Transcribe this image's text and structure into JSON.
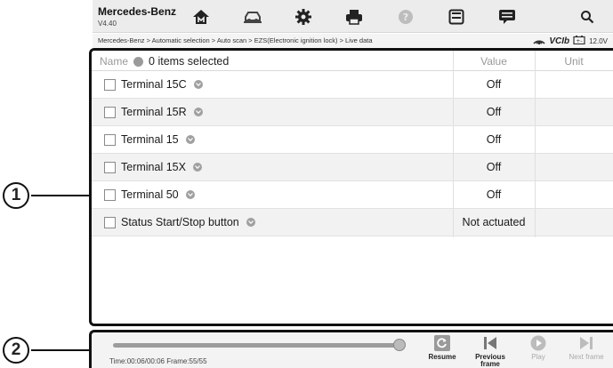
{
  "app": {
    "name": "Mercedes-Benz",
    "version": "V4.40"
  },
  "toolbar": {
    "buttons": [
      {
        "icon": "home-icon"
      },
      {
        "icon": "vehicle-icon"
      },
      {
        "icon": "settings-icon"
      },
      {
        "icon": "print-icon"
      },
      {
        "icon": "help-icon"
      },
      {
        "icon": "save-icon"
      },
      {
        "icon": "message-icon"
      },
      {
        "icon": "search-icon"
      }
    ]
  },
  "breadcrumb": "Mercedes-Benz > Automatic selection > Auto scan > EZS(Electronic ignition lock) > Live data",
  "status": {
    "vci_label": "VCIb",
    "voltage": "12.0V"
  },
  "table": {
    "columns": {
      "name": "Name",
      "selected": "0 items selected",
      "value": "Value",
      "unit": "Unit"
    },
    "rows": [
      {
        "name": "Terminal 15C",
        "value": "Off",
        "unit": ""
      },
      {
        "name": "Terminal 15R",
        "value": "Off",
        "unit": ""
      },
      {
        "name": "Terminal 15",
        "value": "Off",
        "unit": ""
      },
      {
        "name": "Terminal 15X",
        "value": "Off",
        "unit": ""
      },
      {
        "name": "Terminal 50",
        "value": "Off",
        "unit": ""
      },
      {
        "name": "Status Start/Stop button",
        "value": "Not actuated",
        "unit": ""
      }
    ]
  },
  "playback": {
    "time_text": "Time:00:06/00:06  Frame:55/55",
    "progress": 1.0,
    "controls": [
      {
        "label": "Resume",
        "icon": "resume-icon",
        "enabled": true
      },
      {
        "label": "Previous frame",
        "icon": "previous-frame-icon",
        "enabled": true
      },
      {
        "label": "Play",
        "icon": "play-icon",
        "enabled": false
      },
      {
        "label": "Next frame",
        "icon": "next-frame-icon",
        "enabled": false
      }
    ]
  },
  "callouts": [
    "1",
    "2"
  ]
}
